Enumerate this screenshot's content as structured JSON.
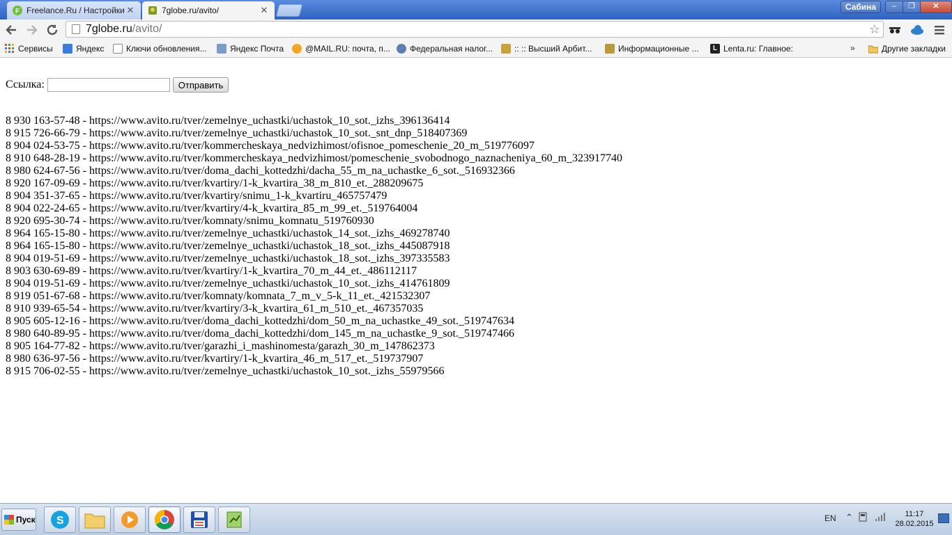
{
  "browser": {
    "tabs": [
      {
        "title": "Freelance.Ru / Настройки",
        "active": false
      },
      {
        "title": "7globe.ru/avito/",
        "active": true
      }
    ],
    "user_name": "Сабина",
    "window_controls": {
      "minimize": "–",
      "maximize": "❐",
      "close": "✕"
    },
    "address": {
      "host": "7globe.ru",
      "path": "/avito/"
    },
    "bookmarks": [
      {
        "label": "Сервисы",
        "icon": "apps-grid-icon",
        "color": "#d84a3a"
      },
      {
        "label": "Яндекс",
        "icon": "yandex-icon",
        "color": "#3b7ddd"
      },
      {
        "label": "Ключи обновления...",
        "icon": "page-icon",
        "color": "#ffffff"
      },
      {
        "label": "Яндекс Почта",
        "icon": "mail-icon",
        "color": "#7a9cc8"
      },
      {
        "label": "@MAIL.RU: почта, п...",
        "icon": "mailru-icon",
        "color": "#f5a623"
      },
      {
        "label": "Федеральная налог...",
        "icon": "tax-service-icon",
        "color": "#5a7fb0"
      },
      {
        "label": ":: :: Высший Арбит...",
        "icon": "arbitration-emblem-icon",
        "color": "#c8a23a"
      },
      {
        "label": "Информационные ...",
        "icon": "eagle-emblem-icon",
        "color": "#b89a3c"
      },
      {
        "label": "Lenta.ru: Главное:",
        "icon": "lenta-icon",
        "color": "#222222"
      }
    ],
    "bookmarks_overflow": "»",
    "other_bookmarks": "Другие закладки"
  },
  "page": {
    "form": {
      "label": "Ссылка:",
      "input_value": "",
      "submit_label": "Отправить"
    },
    "results": [
      "8 930 163-57-48 - https://www.avito.ru/tver/zemelnye_uchastki/uchastok_10_sot._izhs_396136414",
      "8 915 726-66-79 - https://www.avito.ru/tver/zemelnye_uchastki/uchastok_10_sot._snt_dnp_518407369",
      "8 904 024-53-75 - https://www.avito.ru/tver/kommercheskaya_nedvizhimost/ofisnoe_pomeschenie_20_m_519776097",
      "8 910 648-28-19 - https://www.avito.ru/tver/kommercheskaya_nedvizhimost/pomeschenie_svobodnogo_naznacheniya_60_m_323917740",
      "8 980 624-67-56 - https://www.avito.ru/tver/doma_dachi_kottedzhi/dacha_55_m_na_uchastke_6_sot._516932366",
      "8 920 167-09-69 - https://www.avito.ru/tver/kvartiry/1-k_kvartira_38_m_810_et._288209675",
      "8 904 351-37-65 - https://www.avito.ru/tver/kvartiry/snimu_1-k_kvartiru_465757479",
      "8 904 022-24-65 - https://www.avito.ru/tver/kvartiry/4-k_kvartira_85_m_99_et._519764004",
      "8 920 695-30-74 - https://www.avito.ru/tver/komnaty/snimu_komnatu_519760930",
      "8 964 165-15-80 - https://www.avito.ru/tver/zemelnye_uchastki/uchastok_14_sot._izhs_469278740",
      "8 964 165-15-80 - https://www.avito.ru/tver/zemelnye_uchastki/uchastok_18_sot._izhs_445087918",
      "8 904 019-51-69 - https://www.avito.ru/tver/zemelnye_uchastki/uchastok_18_sot._izhs_397335583",
      "8 903 630-69-89 - https://www.avito.ru/tver/kvartiry/1-k_kvartira_70_m_44_et._486112117",
      "8 904 019-51-69 - https://www.avito.ru/tver/zemelnye_uchastki/uchastok_10_sot._izhs_414761809",
      "8 919 051-67-68 - https://www.avito.ru/tver/komnaty/komnata_7_m_v_5-k_11_et._421532307",
      "8 910 939-65-54 - https://www.avito.ru/tver/kvartiry/3-k_kvartira_61_m_510_et._467357035",
      "8 905 605-12-16 - https://www.avito.ru/tver/doma_dachi_kottedzhi/dom_50_m_na_uchastke_49_sot._519747634",
      "8 980 640-89-95 - https://www.avito.ru/tver/doma_dachi_kottedzhi/dom_145_m_na_uchastke_9_sot._519747466",
      "8 905 164-77-82 - https://www.avito.ru/tver/garazhi_i_mashinomesta/garazh_30_m_147862373",
      "8 980 636-97-56 - https://www.avito.ru/tver/kvartiry/1-k_kvartira_46_m_517_et._519737907",
      "8 915 706-02-55 - https://www.avito.ru/tver/zemelnye_uchastki/uchastok_10_sot._izhs_55979566"
    ]
  },
  "taskbar": {
    "start_label": "Пуск",
    "apps": [
      {
        "name": "skype-icon"
      },
      {
        "name": "file-explorer-icon"
      },
      {
        "name": "media-player-icon"
      },
      {
        "name": "chrome-icon",
        "active": true
      },
      {
        "name": "save-disk-icon"
      },
      {
        "name": "notepad-plus-icon"
      }
    ],
    "language": "EN",
    "clock": {
      "time": "11:17",
      "date": "28.02.2015"
    }
  }
}
